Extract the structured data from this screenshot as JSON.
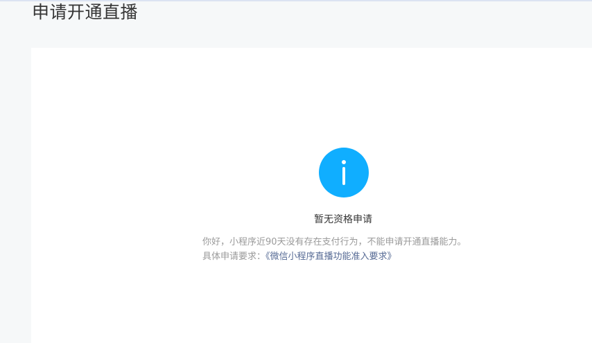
{
  "page": {
    "title": "申请开通直播"
  },
  "status": {
    "icon": "info-icon",
    "icon_color": "#10aeff",
    "title": "暂无资格申请",
    "message": "你好，小程序近90天没有存在支付行为，不能申请开通直播能力。",
    "requirement_label": "具体申请要求：",
    "requirement_link": "《微信小程序直播功能准入要求》",
    "link_color": "#576b95"
  }
}
